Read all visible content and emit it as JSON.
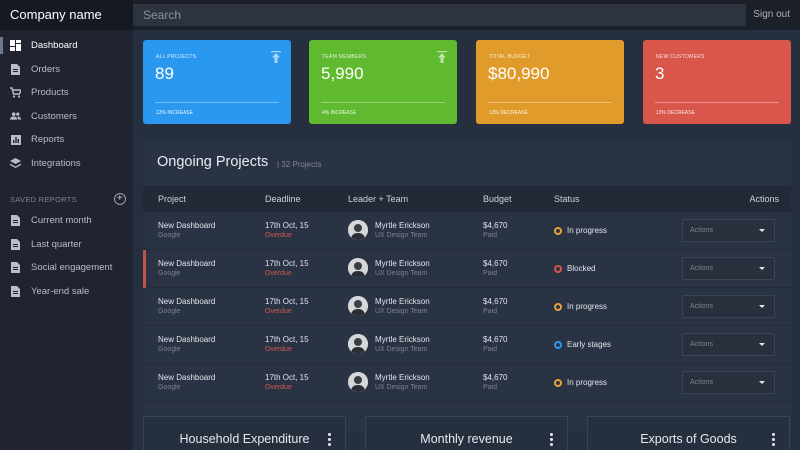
{
  "app": {
    "brand": "Company name",
    "sign_out": "Sign out"
  },
  "search": {
    "placeholder": "Search"
  },
  "sidebar": {
    "items": [
      {
        "label": "Dashboard",
        "icon": "dashboard-icon"
      },
      {
        "label": "Orders",
        "icon": "file-icon"
      },
      {
        "label": "Products",
        "icon": "cart-icon"
      },
      {
        "label": "Customers",
        "icon": "users-icon"
      },
      {
        "label": "Reports",
        "icon": "bar-chart-icon"
      },
      {
        "label": "Integrations",
        "icon": "layers-icon"
      }
    ],
    "saved_title": "SAVED REPORTS",
    "saved": [
      {
        "label": "Current month"
      },
      {
        "label": "Last quarter"
      },
      {
        "label": "Social engagement"
      },
      {
        "label": "Year-end sale"
      }
    ]
  },
  "cards": [
    {
      "label": "ALL PROJECTS",
      "value": "89",
      "foot": "12% INCREASE",
      "color": "#2b98f0"
    },
    {
      "label": "TEAM MEMBERS",
      "value": "5,990",
      "foot": "4% INCREASE",
      "color": "#5fba2f"
    },
    {
      "label": "TOTAL BUDGET",
      "value": "$80,990",
      "foot": "13% DECREASE",
      "color": "#e09b2a"
    },
    {
      "label": "NEW CUSTOMERS",
      "value": "3",
      "foot": "13% DECREASE",
      "color": "#d9564b"
    }
  ],
  "projects": {
    "title": "Ongoing Projects",
    "count": "| 32 Projects",
    "headers": [
      "Project",
      "Deadline",
      "Leader + Team",
      "Budget",
      "Status",
      "Actions"
    ],
    "rows": [
      {
        "project": "New Dashboard",
        "client": "Google",
        "deadline": "17th Oct, 15",
        "due": "Overdue",
        "leader": "Myrtle Erickson",
        "team": "UX Design Team",
        "budget": "$4,670",
        "paid": "Paid",
        "status": "In progress",
        "status_color": "#e6a23c",
        "action": "Actions"
      },
      {
        "project": "New Dashboard",
        "client": "Google",
        "deadline": "17th Oct, 15",
        "due": "Overdue",
        "leader": "Myrtle Erickson",
        "team": "UX Design Team",
        "budget": "$4,670",
        "paid": "Paid",
        "status": "Blocked",
        "status_color": "#d9564b",
        "action": "Actions"
      },
      {
        "project": "New Dashboard",
        "client": "Google",
        "deadline": "17th Oct, 15",
        "due": "Overdue",
        "leader": "Myrtle Erickson",
        "team": "UX Design Team",
        "budget": "$4,670",
        "paid": "Paid",
        "status": "In progress",
        "status_color": "#e6a23c",
        "action": "Actions"
      },
      {
        "project": "New Dashboard",
        "client": "Google",
        "deadline": "17th Oct, 15",
        "due": "Overdue",
        "leader": "Myrtle Erickson",
        "team": "UX Design Team",
        "budget": "$4,670",
        "paid": "Paid",
        "status": "Early stages",
        "status_color": "#2b98f0",
        "action": "Actions"
      },
      {
        "project": "New Dashboard",
        "client": "Google",
        "deadline": "17th Oct, 15",
        "due": "Overdue",
        "leader": "Myrtle Erickson",
        "team": "UX Design Team",
        "budget": "$4,670",
        "paid": "Paid",
        "status": "In progress",
        "status_color": "#e6a23c",
        "action": "Actions"
      }
    ]
  },
  "minis": [
    {
      "title": "Household Expenditure"
    },
    {
      "title": "Monthly revenue"
    },
    {
      "title": "Exports of Goods"
    }
  ]
}
